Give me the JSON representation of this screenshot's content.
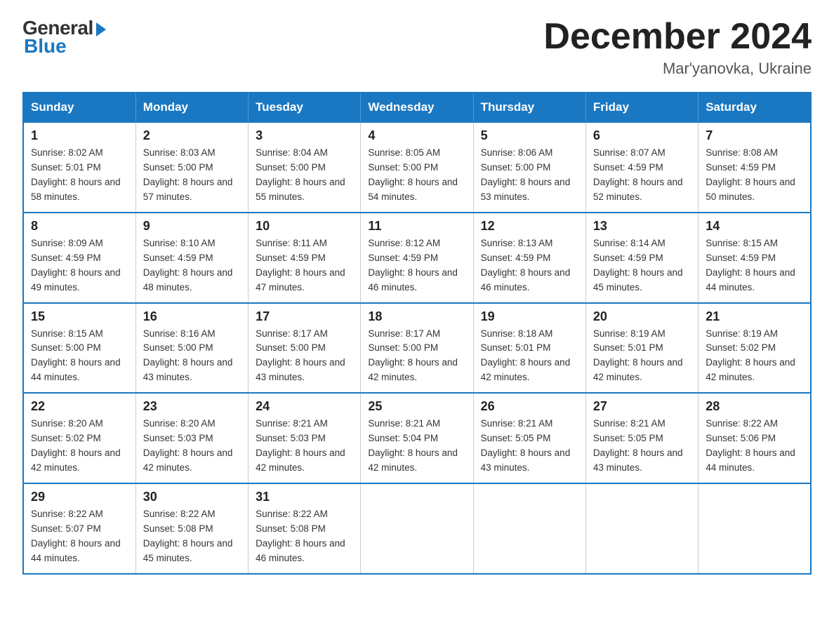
{
  "header": {
    "logo_general": "General",
    "logo_blue": "Blue",
    "month_title": "December 2024",
    "location": "Mar'yanovka, Ukraine"
  },
  "days_of_week": [
    "Sunday",
    "Monday",
    "Tuesday",
    "Wednesday",
    "Thursday",
    "Friday",
    "Saturday"
  ],
  "weeks": [
    [
      {
        "day": "1",
        "sunrise": "8:02 AM",
        "sunset": "5:01 PM",
        "daylight": "8 hours and 58 minutes."
      },
      {
        "day": "2",
        "sunrise": "8:03 AM",
        "sunset": "5:00 PM",
        "daylight": "8 hours and 57 minutes."
      },
      {
        "day": "3",
        "sunrise": "8:04 AM",
        "sunset": "5:00 PM",
        "daylight": "8 hours and 55 minutes."
      },
      {
        "day": "4",
        "sunrise": "8:05 AM",
        "sunset": "5:00 PM",
        "daylight": "8 hours and 54 minutes."
      },
      {
        "day": "5",
        "sunrise": "8:06 AM",
        "sunset": "5:00 PM",
        "daylight": "8 hours and 53 minutes."
      },
      {
        "day": "6",
        "sunrise": "8:07 AM",
        "sunset": "4:59 PM",
        "daylight": "8 hours and 52 minutes."
      },
      {
        "day": "7",
        "sunrise": "8:08 AM",
        "sunset": "4:59 PM",
        "daylight": "8 hours and 50 minutes."
      }
    ],
    [
      {
        "day": "8",
        "sunrise": "8:09 AM",
        "sunset": "4:59 PM",
        "daylight": "8 hours and 49 minutes."
      },
      {
        "day": "9",
        "sunrise": "8:10 AM",
        "sunset": "4:59 PM",
        "daylight": "8 hours and 48 minutes."
      },
      {
        "day": "10",
        "sunrise": "8:11 AM",
        "sunset": "4:59 PM",
        "daylight": "8 hours and 47 minutes."
      },
      {
        "day": "11",
        "sunrise": "8:12 AM",
        "sunset": "4:59 PM",
        "daylight": "8 hours and 46 minutes."
      },
      {
        "day": "12",
        "sunrise": "8:13 AM",
        "sunset": "4:59 PM",
        "daylight": "8 hours and 46 minutes."
      },
      {
        "day": "13",
        "sunrise": "8:14 AM",
        "sunset": "4:59 PM",
        "daylight": "8 hours and 45 minutes."
      },
      {
        "day": "14",
        "sunrise": "8:15 AM",
        "sunset": "4:59 PM",
        "daylight": "8 hours and 44 minutes."
      }
    ],
    [
      {
        "day": "15",
        "sunrise": "8:15 AM",
        "sunset": "5:00 PM",
        "daylight": "8 hours and 44 minutes."
      },
      {
        "day": "16",
        "sunrise": "8:16 AM",
        "sunset": "5:00 PM",
        "daylight": "8 hours and 43 minutes."
      },
      {
        "day": "17",
        "sunrise": "8:17 AM",
        "sunset": "5:00 PM",
        "daylight": "8 hours and 43 minutes."
      },
      {
        "day": "18",
        "sunrise": "8:17 AM",
        "sunset": "5:00 PM",
        "daylight": "8 hours and 42 minutes."
      },
      {
        "day": "19",
        "sunrise": "8:18 AM",
        "sunset": "5:01 PM",
        "daylight": "8 hours and 42 minutes."
      },
      {
        "day": "20",
        "sunrise": "8:19 AM",
        "sunset": "5:01 PM",
        "daylight": "8 hours and 42 minutes."
      },
      {
        "day": "21",
        "sunrise": "8:19 AM",
        "sunset": "5:02 PM",
        "daylight": "8 hours and 42 minutes."
      }
    ],
    [
      {
        "day": "22",
        "sunrise": "8:20 AM",
        "sunset": "5:02 PM",
        "daylight": "8 hours and 42 minutes."
      },
      {
        "day": "23",
        "sunrise": "8:20 AM",
        "sunset": "5:03 PM",
        "daylight": "8 hours and 42 minutes."
      },
      {
        "day": "24",
        "sunrise": "8:21 AM",
        "sunset": "5:03 PM",
        "daylight": "8 hours and 42 minutes."
      },
      {
        "day": "25",
        "sunrise": "8:21 AM",
        "sunset": "5:04 PM",
        "daylight": "8 hours and 42 minutes."
      },
      {
        "day": "26",
        "sunrise": "8:21 AM",
        "sunset": "5:05 PM",
        "daylight": "8 hours and 43 minutes."
      },
      {
        "day": "27",
        "sunrise": "8:21 AM",
        "sunset": "5:05 PM",
        "daylight": "8 hours and 43 minutes."
      },
      {
        "day": "28",
        "sunrise": "8:22 AM",
        "sunset": "5:06 PM",
        "daylight": "8 hours and 44 minutes."
      }
    ],
    [
      {
        "day": "29",
        "sunrise": "8:22 AM",
        "sunset": "5:07 PM",
        "daylight": "8 hours and 44 minutes."
      },
      {
        "day": "30",
        "sunrise": "8:22 AM",
        "sunset": "5:08 PM",
        "daylight": "8 hours and 45 minutes."
      },
      {
        "day": "31",
        "sunrise": "8:22 AM",
        "sunset": "5:08 PM",
        "daylight": "8 hours and 46 minutes."
      },
      null,
      null,
      null,
      null
    ]
  ]
}
